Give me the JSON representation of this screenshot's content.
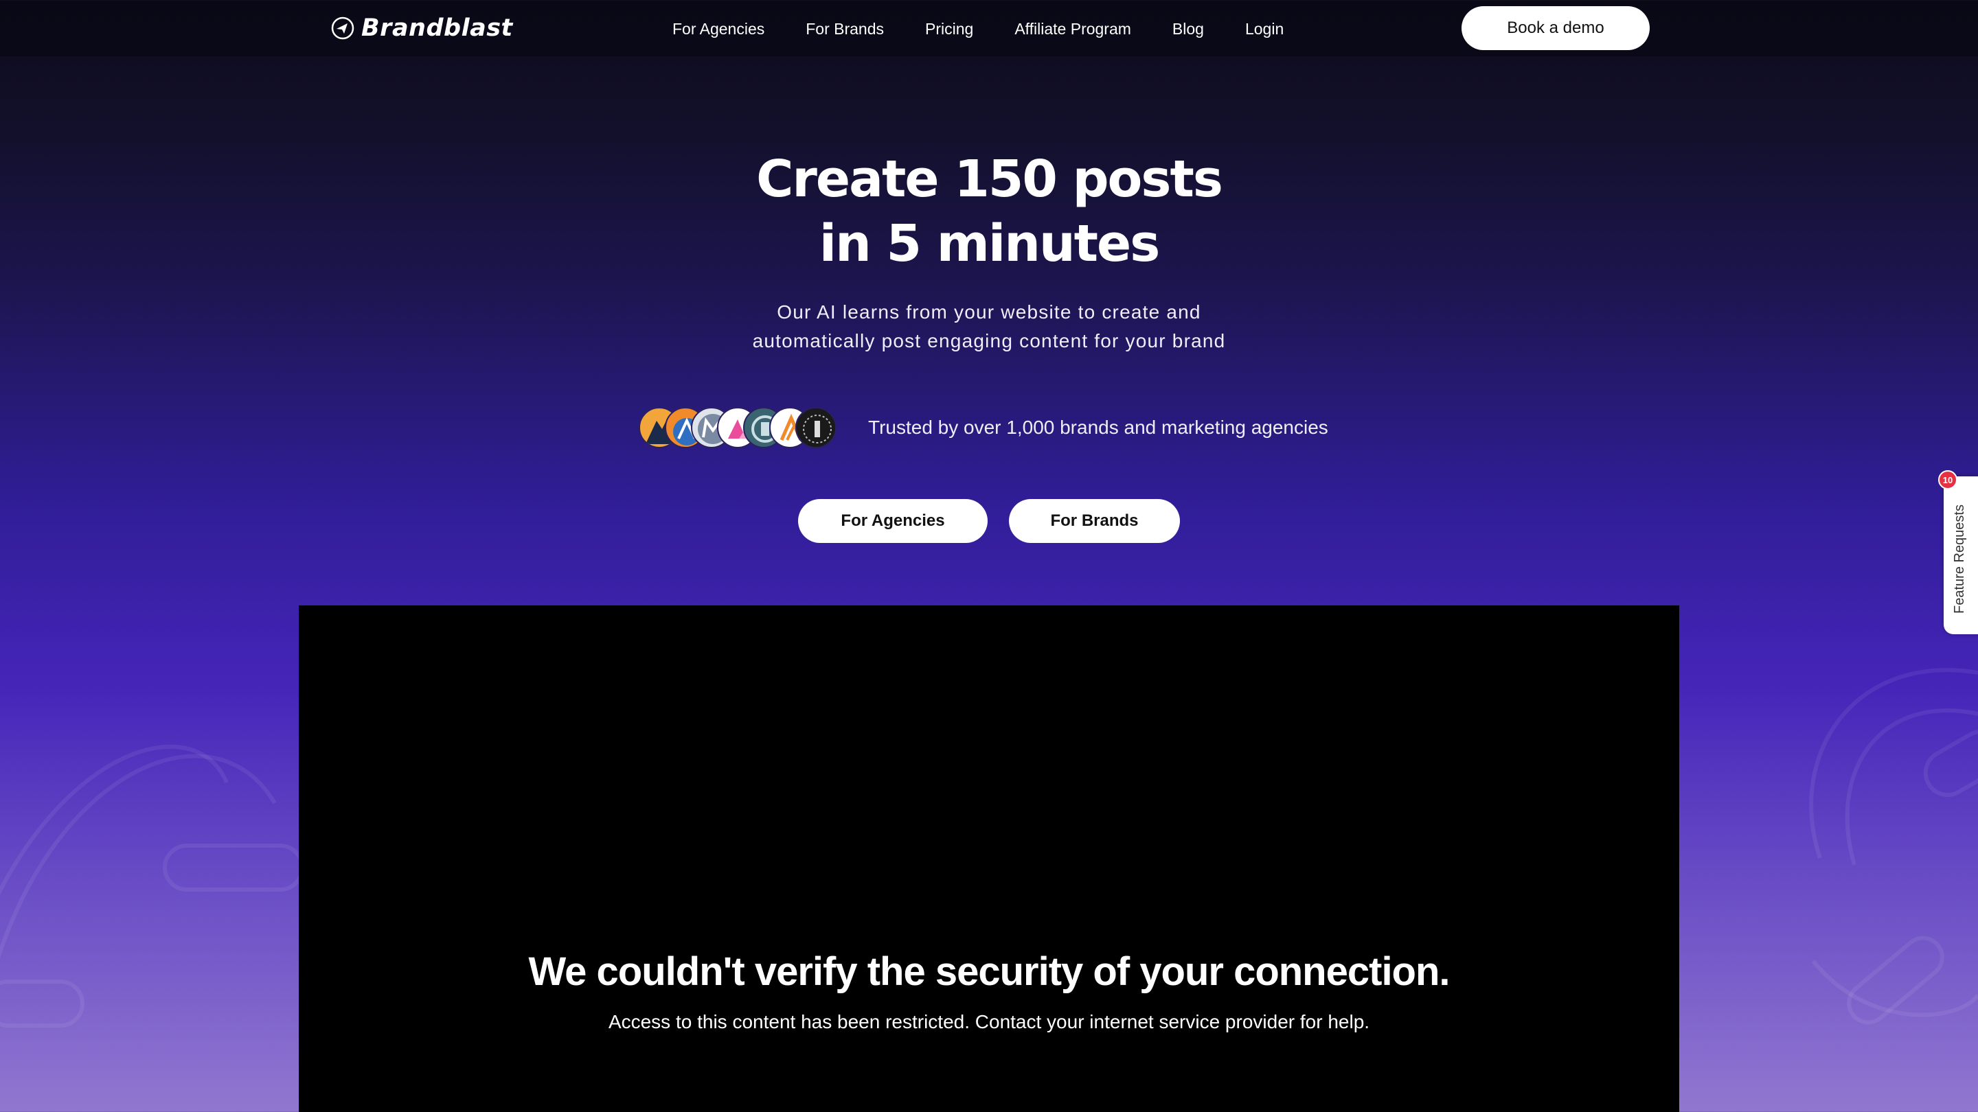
{
  "nav": {
    "logo": "Brandblast",
    "links": [
      "For Agencies",
      "For Brands",
      "Pricing",
      "Affiliate Program",
      "Blog",
      "Login"
    ],
    "cta": "Book a demo"
  },
  "hero": {
    "title_line1": "Create 150 posts",
    "title_line2": "in 5 minutes",
    "subtitle_line1": "Our AI learns from your website to create and",
    "subtitle_line2": "automatically post engaging content for your brand",
    "trust": "Trusted by over 1,000 brands and marketing agencies",
    "buttons": [
      "For Agencies",
      "For Brands"
    ]
  },
  "video_block": {
    "title": "We couldn't verify the security of your connection.",
    "message": "Access to this content has been restricted. Contact your internet service provider for help."
  },
  "feature_widget": {
    "label": "Feature Requests",
    "badge": "10"
  },
  "colors": {
    "background_top": "#0d0b1c",
    "background_bottom": "#9277d0",
    "badge": "#e53144"
  }
}
